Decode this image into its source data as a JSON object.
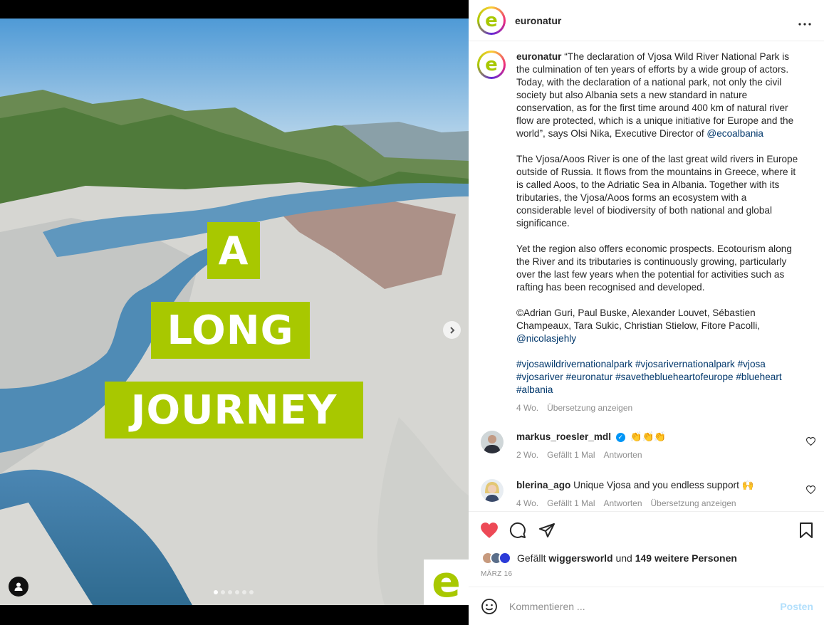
{
  "media": {
    "overlay_words": [
      "A",
      "LONG",
      "JOURNEY"
    ],
    "logo_letter": "e",
    "carousel": {
      "total": 6,
      "current": 1
    },
    "brand_green": "#a8c800"
  },
  "header": {
    "username": "euronatur",
    "avatar_letter": "e",
    "more_icon": "more-horizontal-icon"
  },
  "caption": {
    "username": "euronatur",
    "paragraphs": [
      "“The declaration of Vjosa Wild River National Park is the culmination of ten years of efforts by a wide group of actors. Today, with the declaration of a national park, not only the civil society but also Albania sets a new standard in nature conservation, as for the first time around 400 km of natural river flow are protected, which is a unique initiative for Europe and the world”, says Olsi Nika, Executive Director of",
      "The Vjosa/Aoos River is one of the last great wild rivers in Europe outside of Russia. It flows from the mountains in Greece, where it is called Aoos, to the Adriatic Sea in Albania. Together with its tributaries, the Vjosa/Aoos forms an ecosystem with a considerable level of biodiversity of both national and global significance.",
      "Yet the region also offers economic prospects. Ecotourism along the River and its tributaries is continuously growing, particularly over the last few years when the potential for activities such as rafting has been recognised and developed.",
      "©Adrian Guri, Paul Buske, Alexander Louvet, Sébastien Champeaux, Tara Sukic, Christian Stielow, Fitore Pacolli,"
    ],
    "mention_1": "@ecoalbania",
    "mention_2": "@nicolasjehly",
    "hashtags": [
      "#vjosawildrivernationalpark",
      "#vjosarivernationalpark",
      "#vjosa",
      "#vjosariver",
      "#euronatur",
      "#savetheblueheartofeurope",
      "#blueheart",
      "#albania"
    ],
    "time": "4 Wo.",
    "translate": "Übersetzung anzeigen"
  },
  "comments": [
    {
      "username": "markus_roesler_mdl",
      "verified": true,
      "text": "👏👏👏",
      "time": "2 Wo.",
      "likes": "Gefällt 1 Mal",
      "reply": "Antworten"
    },
    {
      "username": "blerina_ago",
      "verified": false,
      "text": "Unique Vjosa and you endless support 🙌",
      "time": "4 Wo.",
      "likes": "Gefällt 1 Mal",
      "reply": "Antworten",
      "translate": "Übersetzung anzeigen"
    }
  ],
  "actions": {
    "liked": true,
    "like_color": "#ed4956",
    "likes_prefix": "Gefällt",
    "likes_user": "wiggersworld",
    "likes_and": "und",
    "likes_others": "149 weitere Personen",
    "date": "MÄRZ 16"
  },
  "add_comment": {
    "placeholder": "Kommentieren ...",
    "post_label": "Posten"
  }
}
